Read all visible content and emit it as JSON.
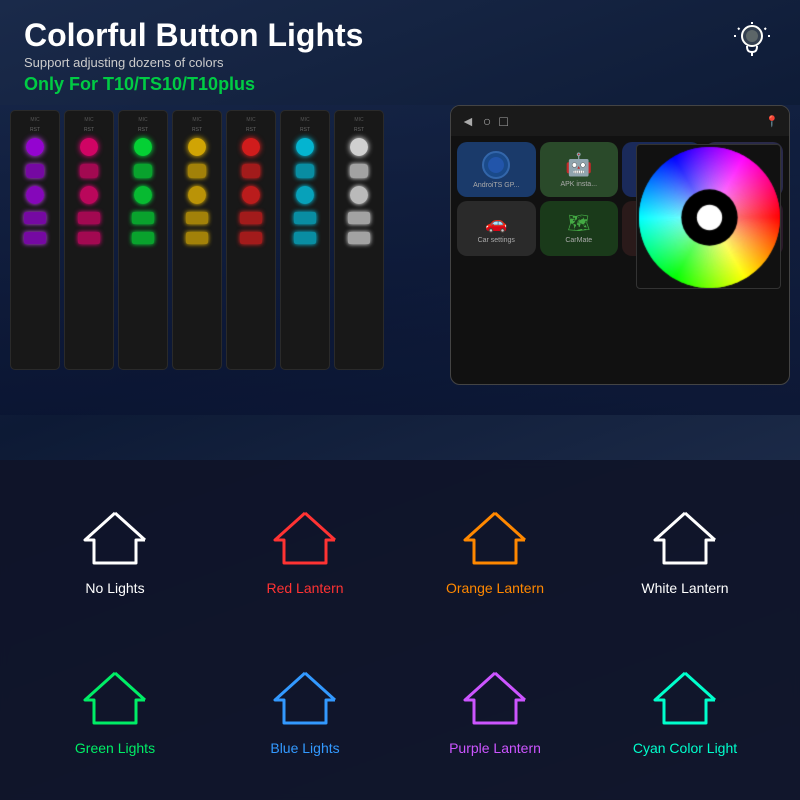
{
  "header": {
    "title": "Colorful Button Lights",
    "subtitle": "Support adjusting dozens of colors",
    "model_label": "Only For T10/TS10/T10plus",
    "lightbulb_symbol": "💡"
  },
  "colors": {
    "accent_green": "#00cc44",
    "background": "#1a2a4a"
  },
  "light_options": [
    {
      "id": "no-lights",
      "label": "No Lights",
      "color": "#ffffff",
      "row": 0,
      "col": 0
    },
    {
      "id": "red-lantern",
      "label": "Red Lantern",
      "color": "#ff3333",
      "row": 0,
      "col": 1
    },
    {
      "id": "orange-lantern",
      "label": "Orange Lantern",
      "color": "#ff8800",
      "row": 0,
      "col": 2
    },
    {
      "id": "white-lantern",
      "label": "White Lantern",
      "color": "#ffffff",
      "row": 0,
      "col": 3
    },
    {
      "id": "green-lights",
      "label": "Green Lights",
      "color": "#00ee66",
      "row": 1,
      "col": 0
    },
    {
      "id": "blue-lights",
      "label": "Blue Lights",
      "color": "#3399ff",
      "row": 1,
      "col": 1
    },
    {
      "id": "purple-lantern",
      "label": "Purple Lantern",
      "color": "#cc55ff",
      "row": 1,
      "col": 2
    },
    {
      "id": "cyan-color-light",
      "label": "Cyan Color Light",
      "color": "#00ffcc",
      "row": 1,
      "col": 3
    }
  ],
  "panels": [
    {
      "color_scheme": "purple"
    },
    {
      "color_scheme": "pink"
    },
    {
      "color_scheme": "green"
    },
    {
      "color_scheme": "yellow"
    },
    {
      "color_scheme": "red"
    },
    {
      "color_scheme": "cyan"
    },
    {
      "color_scheme": "white"
    }
  ]
}
